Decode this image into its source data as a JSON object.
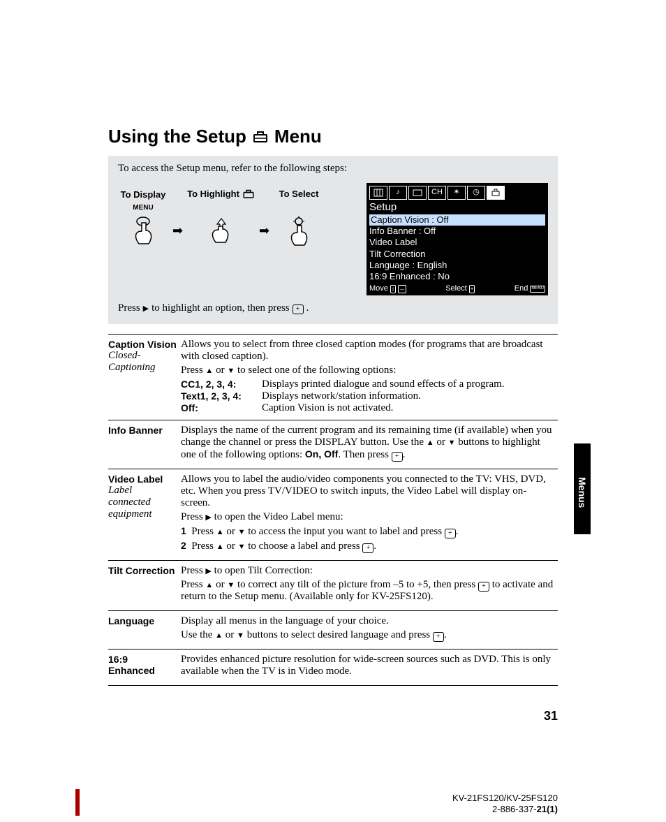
{
  "title_pre": "Using the Setup",
  "title_post": "Menu",
  "intro": "To access the Setup menu, refer to the following steps:",
  "steps": {
    "display": "To Display",
    "highlight": "To Highlight",
    "select": "To Select",
    "menu_btn": "MENU"
  },
  "press_line_a": "Press",
  "press_line_b": "to highlight an option, then press",
  "osd": {
    "title": "Setup",
    "lines": [
      "Caption Vision : Off",
      "Info Banner : Off",
      "Video Label",
      "Tilt Correction",
      "Language : English",
      "16:9 Enhanced : No"
    ],
    "move": "Move",
    "select": "Select",
    "end": "End"
  },
  "rows": {
    "caption": {
      "label1": "Caption Vision",
      "label2": "Closed-Captioning",
      "p1": "Allows you to select from three closed caption modes (for programs that are broadcast with closed caption).",
      "p2a": "Press",
      "p2b": "or",
      "p2c": "to select one of the following options:",
      "cc_k": "CC1, 2, 3, 4:",
      "cc_v": "Displays printed dialogue and sound effects of a program.",
      "tx_k": "Text1, 2, 3, 4:",
      "tx_v": "Displays network/station information.",
      "off_k": "Off:",
      "off_v": "Caption Vision is not activated."
    },
    "info": {
      "label": "Info Banner",
      "p_a": "Displays the name of the current program and its remaining time (if available) when you change the channel or press the DISPLAY button. Use the",
      "p_b": "or",
      "p_c": "buttons to highlight one of the following options:",
      "p_on": "On, Off",
      "p_d": ". Then press",
      "p_e": "."
    },
    "video": {
      "label1": "Video Label",
      "label2": "Label connected equipment",
      "p1": "Allows you to label the audio/video components you connected to the TV: VHS, DVD, etc. When you press TV/VIDEO to switch inputs, the Video Label will display on-screen.",
      "p2a": "Press",
      "p2b": "to open the Video Label menu:",
      "s1n": "1",
      "s1a": "Press",
      "s1b": "or",
      "s1c": "to access the input you want to label and press",
      "s2n": "2",
      "s2a": "Press",
      "s2b": "or",
      "s2c": "to choose a label and press"
    },
    "tilt": {
      "label": "Tilt Correction",
      "p1a": "Press",
      "p1b": "to open Tilt Correction:",
      "p2a": "Press",
      "p2b": "or",
      "p2c": "to correct any tilt of the picture from –5 to +5, then press",
      "p2d": "to activate and return to the Setup menu. (Available only for KV-25FS120)."
    },
    "lang": {
      "label": "Language",
      "p1": "Display all menus in the language of your choice.",
      "p2a": "Use the",
      "p2b": "or",
      "p2c": "buttons to select desired language and press"
    },
    "enh": {
      "label": "16:9 Enhanced",
      "p1": "Provides enhanced picture resolution for wide-screen sources such as DVD. This is only available when the TV is in Video mode."
    }
  },
  "side_tab": "Menus",
  "pagenum": "31",
  "footer_model": "KV-21FS120/KV-25FS120",
  "footer_code_a": "2-886-337-",
  "footer_code_b": "21(1)"
}
